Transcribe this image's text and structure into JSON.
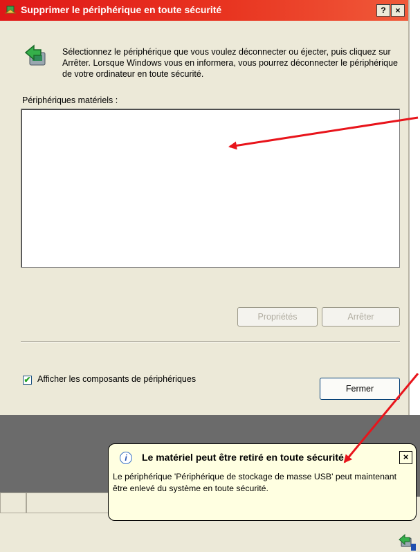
{
  "dialog": {
    "title": "Supprimer le périphérique en toute sécurité",
    "help_label": "?",
    "close_label": "×",
    "instructions": "Sélectionnez le périphérique que vous voulez déconnecter ou éjecter, puis cliquez sur Arrêter. Lorsque Windows vous en informera, vous pourrez déconnecter le périphérique de votre ordinateur en toute sécurité.",
    "hardware_label": "Périphériques matériels :",
    "hardware_items": [],
    "properties_label": "Propriétés",
    "stop_label": "Arrêter",
    "checkbox_label": "Afficher les composants de périphériques",
    "checkbox_checked": true,
    "checkbox_mark": "✔",
    "close_button_label": "Fermer"
  },
  "notification": {
    "info_icon": "i",
    "title": "Le matériel peut être retiré en toute sécurité",
    "close_label": "×",
    "body": "Le périphérique 'Périphérique de stockage de masse USB' peut maintenant être enlevé du système en toute sécurité."
  },
  "colors": {
    "titlebar": "#e01818",
    "dialog_bg": "#ece9d8",
    "tooltip_bg": "#ffffe1",
    "annotation_arrow": "#e8141b"
  },
  "icons": [
    "safely-remove-hardware-icon",
    "info-icon",
    "tray-safely-remove-icon"
  ]
}
